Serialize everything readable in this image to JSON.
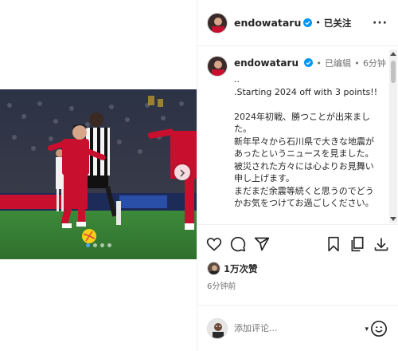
{
  "colors": {
    "accent": "#0095f6",
    "verified": "#0095f6",
    "text": "#262626",
    "muted": "#737373"
  },
  "media": {
    "carousel_dots": 4,
    "active_dot": 0,
    "next_icon": "chevron-right-icon"
  },
  "header": {
    "username": "endowataru",
    "separator": "•",
    "follow_status": "已关注",
    "more_icon": "more-horizontal-icon",
    "more_label": "···"
  },
  "caption": {
    "username": "endowataru",
    "separator": "•",
    "edited": "已编辑",
    "time": "6分钟",
    "text": "..\n.Starting 2024 off with 3 points!!\n\n2024年初戦、勝つことが出来まし\nた。\n新年早々から石川県で大きな地震が\nあったというニュースを見ました。\n被災された方々には心よりお見舞い\n申し上げます。\nまだまだ余震等続くと思うのでどう\nかお気をつけてお過ごしください。"
  },
  "actions": {
    "like_icon": "heart-icon",
    "comment_icon": "comment-icon",
    "share_icon": "send-icon",
    "save_icon": "bookmark-icon",
    "copy_icon": "copy-icon",
    "download_icon": "download-icon"
  },
  "likes": {
    "count_label": "1万次赞"
  },
  "post_time": "6分钟前",
  "add_comment": {
    "placeholder": "添加评论...",
    "emoji_icon": "emoji-icon",
    "caret": "▾"
  }
}
